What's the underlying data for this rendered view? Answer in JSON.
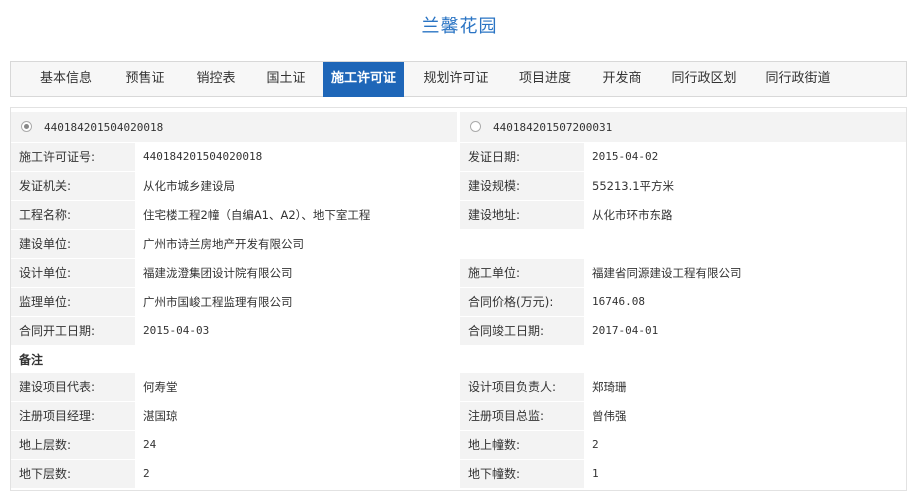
{
  "page_title": "兰馨花园",
  "tabs": [
    {
      "label": "基本信息",
      "active": false
    },
    {
      "label": "预售证",
      "active": false
    },
    {
      "label": "销控表",
      "active": false
    },
    {
      "label": "国土证",
      "active": false
    },
    {
      "label": "施工许可证",
      "active": true
    },
    {
      "label": "规划许可证",
      "active": false
    },
    {
      "label": "项目进度",
      "active": false
    },
    {
      "label": "开发商",
      "active": false
    },
    {
      "label": "同行政区划",
      "active": false
    },
    {
      "label": "同行政街道",
      "active": false
    }
  ],
  "permits": [
    {
      "number": "440184201504020018",
      "selected": true
    },
    {
      "number": "440184201507200031",
      "selected": false
    }
  ],
  "fields": {
    "permit_no": {
      "label": "施工许可证号:",
      "value": "440184201504020018"
    },
    "issue_date": {
      "label": "发证日期:",
      "value": "2015-04-02"
    },
    "issuer": {
      "label": "发证机关:",
      "value": "从化市城乡建设局"
    },
    "scale": {
      "label": "建设规模:",
      "value": "55213.1平方米"
    },
    "project_name": {
      "label": "工程名称:",
      "value": "住宅楼工程2幢（自编A1、A2）、地下室工程"
    },
    "address": {
      "label": "建设地址:",
      "value": "从化市环市东路"
    },
    "builder": {
      "label": "建设单位:",
      "value": "广州市诗兰房地产开发有限公司"
    },
    "designer": {
      "label": "设计单位:",
      "value": "福建泷澄集团设计院有限公司"
    },
    "contractor": {
      "label": "施工单位:",
      "value": "福建省同源建设工程有限公司"
    },
    "supervisor": {
      "label": "监理单位:",
      "value": "广州市国峻工程监理有限公司"
    },
    "contract_price": {
      "label": "合同价格(万元):",
      "value": "16746.08"
    },
    "start_date": {
      "label": "合同开工日期:",
      "value": "2015-04-03"
    },
    "end_date": {
      "label": "合同竣工日期:",
      "value": "2017-04-01"
    }
  },
  "remarks_heading": "备注",
  "remarks": {
    "rep": {
      "label": "建设项目代表:",
      "value": "何寿堂"
    },
    "design_lead": {
      "label": "设计项目负责人:",
      "value": "郑琦珊"
    },
    "pm": {
      "label": "注册项目经理:",
      "value": "湛国琼"
    },
    "chief_supervisor": {
      "label": "注册项目总监:",
      "value": "曾伟强"
    },
    "floors_above": {
      "label": "地上层数:",
      "value": "24"
    },
    "buildings_above": {
      "label": "地上幢数:",
      "value": "2"
    },
    "floors_below": {
      "label": "地下层数:",
      "value": "2"
    },
    "buildings_below": {
      "label": "地下幢数:",
      "value": "1"
    }
  }
}
